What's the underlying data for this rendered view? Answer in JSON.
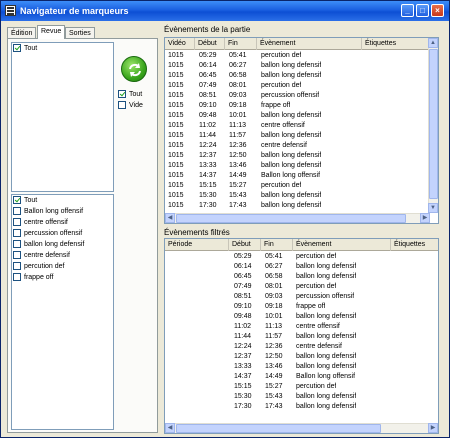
{
  "window": {
    "title": "Navigateur de marqueurs"
  },
  "tabs": [
    {
      "label": "Édition",
      "active": false
    },
    {
      "label": "Revue",
      "active": true
    },
    {
      "label": "Sorties",
      "active": false
    }
  ],
  "top_filter": {
    "items": [
      {
        "label": "Tout",
        "checked": true
      }
    ]
  },
  "side_filter": {
    "items": [
      {
        "label": "Tout",
        "checked": true
      },
      {
        "label": "Vide",
        "checked": false
      }
    ]
  },
  "event_filter": {
    "items": [
      {
        "label": "Tout",
        "checked": true
      },
      {
        "label": "Ballon long offensif",
        "checked": false
      },
      {
        "label": "centre offensif",
        "checked": false
      },
      {
        "label": "percussion offensif",
        "checked": false
      },
      {
        "label": "ballon long defensif",
        "checked": false
      },
      {
        "label": "centre defensif",
        "checked": false
      },
      {
        "label": "percution def",
        "checked": false
      },
      {
        "label": "frappe off",
        "checked": false
      }
    ]
  },
  "events_section": {
    "title": "Évènements de la partie",
    "columns": [
      "Vidéo",
      "Début",
      "Fin",
      "Évènement",
      "Étiquettes"
    ],
    "rows": [
      [
        "1015",
        "05:29",
        "05:41",
        "percution def"
      ],
      [
        "1015",
        "06:14",
        "06:27",
        "ballon long defensif"
      ],
      [
        "1015",
        "06:45",
        "06:58",
        "ballon long defensif"
      ],
      [
        "1015",
        "07:49",
        "08:01",
        "percution def"
      ],
      [
        "1015",
        "08:51",
        "09:03",
        "percussion offensif"
      ],
      [
        "1015",
        "09:10",
        "09:18",
        "frappe off"
      ],
      [
        "1015",
        "09:48",
        "10:01",
        "ballon long defensif"
      ],
      [
        "1015",
        "11:02",
        "11:13",
        "centre offensif"
      ],
      [
        "1015",
        "11:44",
        "11:57",
        "ballon long defensif"
      ],
      [
        "1015",
        "12:24",
        "12:36",
        "centre defensif"
      ],
      [
        "1015",
        "12:37",
        "12:50",
        "ballon long defensif"
      ],
      [
        "1015",
        "13:33",
        "13:46",
        "ballon long defensif"
      ],
      [
        "1015",
        "14:37",
        "14:49",
        "Ballon long offensif"
      ],
      [
        "1015",
        "15:15",
        "15:27",
        "percution def"
      ],
      [
        "1015",
        "15:30",
        "15:43",
        "ballon long defensif"
      ],
      [
        "1015",
        "17:30",
        "17:43",
        "ballon long defensif"
      ]
    ]
  },
  "filtered_section": {
    "title": "Évènements filtrés",
    "columns": [
      "Période",
      "Début",
      "Fin",
      "Évènement",
      "Étiquettes"
    ],
    "rows": [
      [
        "",
        "05:29",
        "05:41",
        "percution def"
      ],
      [
        "",
        "06:14",
        "06:27",
        "ballon long defensif"
      ],
      [
        "",
        "06:45",
        "06:58",
        "ballon long defensif"
      ],
      [
        "",
        "07:49",
        "08:01",
        "percution def"
      ],
      [
        "",
        "08:51",
        "09:03",
        "percussion offensif"
      ],
      [
        "",
        "09:10",
        "09:18",
        "frappe off"
      ],
      [
        "",
        "09:48",
        "10:01",
        "ballon long defensif"
      ],
      [
        "",
        "11:02",
        "11:13",
        "centre offensif"
      ],
      [
        "",
        "11:44",
        "11:57",
        "ballon long defensif"
      ],
      [
        "",
        "12:24",
        "12:36",
        "centre defensif"
      ],
      [
        "",
        "12:37",
        "12:50",
        "ballon long defensif"
      ],
      [
        "",
        "13:33",
        "13:46",
        "ballon long defensif"
      ],
      [
        "",
        "14:37",
        "14:49",
        "Ballon long offensif"
      ],
      [
        "",
        "15:15",
        "15:27",
        "percution def"
      ],
      [
        "",
        "15:30",
        "15:43",
        "ballon long defensif"
      ],
      [
        "",
        "17:30",
        "17:43",
        "ballon long defensif"
      ]
    ]
  },
  "icons": {
    "refresh": "refresh-arrows-icon",
    "app": "window-app-icon"
  },
  "colors": {
    "titlebar": "#0d4fd4",
    "refresh": "#3aa51c",
    "checkmark": "#21a121"
  }
}
